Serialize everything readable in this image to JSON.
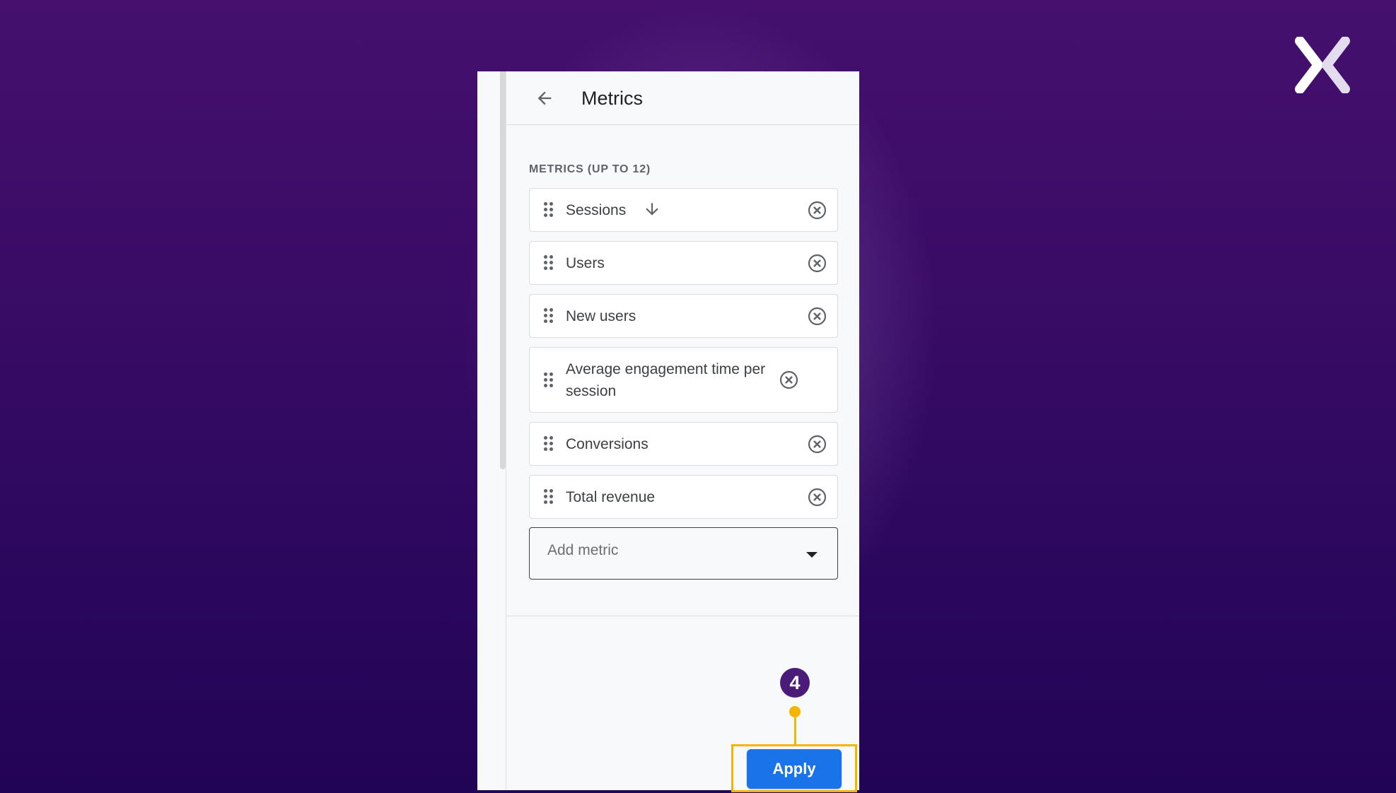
{
  "panel": {
    "title": "Metrics",
    "back_icon": "arrow-left-icon",
    "section_label": "METRICS (UP TO 12)",
    "metrics": [
      {
        "label": "Sessions",
        "sorted": true,
        "sort_direction": "descending"
      },
      {
        "label": "Users",
        "sorted": false
      },
      {
        "label": "New users",
        "sorted": false
      },
      {
        "label": "Average engagement time per session",
        "sorted": false
      },
      {
        "label": "Conversions",
        "sorted": false
      },
      {
        "label": "Total revenue",
        "sorted": false
      }
    ],
    "add_metric": {
      "placeholder": "Add metric"
    },
    "apply_label": "Apply"
  },
  "annotation": {
    "step_number": "4",
    "highlight_color": "#f5b400",
    "badge_color": "#4a1b78"
  },
  "colors": {
    "background": "#3a0c66",
    "primary_button": "#1a73e8"
  },
  "brand": {
    "logo_icon": "x-logo-icon"
  }
}
